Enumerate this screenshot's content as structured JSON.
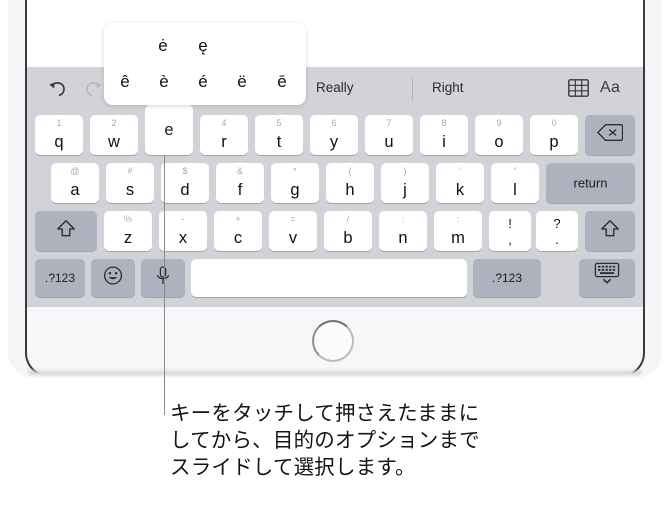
{
  "device": {
    "home_button": "home-button",
    "frame": "ipad-frame"
  },
  "keyboard": {
    "shortcut_bar": {
      "undo_icon": "undo-icon",
      "redo_icon": "redo-icon",
      "predictions": [
        "Really",
        "Right"
      ],
      "table_icon": "table-icon",
      "format_label": "Aa"
    },
    "accent_popup": {
      "row_top": [
        "ė",
        "ę"
      ],
      "row_bottom": [
        "ê",
        "è",
        "é",
        "ë",
        "ē"
      ]
    },
    "row1": [
      {
        "main": "q",
        "sub": "1"
      },
      {
        "main": "w",
        "sub": "2"
      },
      {
        "main": "e",
        "sub": "",
        "pressed": true
      },
      {
        "main": "r",
        "sub": "4"
      },
      {
        "main": "t",
        "sub": "5"
      },
      {
        "main": "y",
        "sub": "6"
      },
      {
        "main": "u",
        "sub": "7"
      },
      {
        "main": "i",
        "sub": "8"
      },
      {
        "main": "o",
        "sub": "9"
      },
      {
        "main": "p",
        "sub": "0"
      }
    ],
    "row1_backspace": "delete-key",
    "row2": [
      {
        "main": "a",
        "sub": "@"
      },
      {
        "main": "s",
        "sub": "#"
      },
      {
        "main": "d",
        "sub": "$"
      },
      {
        "main": "f",
        "sub": "&"
      },
      {
        "main": "g",
        "sub": "*"
      },
      {
        "main": "h",
        "sub": "("
      },
      {
        "main": "j",
        "sub": ")"
      },
      {
        "main": "k",
        "sub": "'"
      },
      {
        "main": "l",
        "sub": "\""
      }
    ],
    "row2_return": "return",
    "row3": [
      {
        "main": "z",
        "sub": "%"
      },
      {
        "main": "x",
        "sub": "-"
      },
      {
        "main": "c",
        "sub": "+"
      },
      {
        "main": "v",
        "sub": "="
      },
      {
        "main": "b",
        "sub": "/"
      },
      {
        "main": "n",
        "sub": ";"
      },
      {
        "main": "m",
        "sub": ":"
      }
    ],
    "row3_punct": [
      {
        "top": "!",
        "bottom": ","
      },
      {
        "top": "?",
        "bottom": "."
      }
    ],
    "row3_shift_left": "shift-key",
    "row3_shift_right": "shift-key",
    "row4": {
      "numeric_left": ".?123",
      "emoji_icon": "emoji-icon",
      "dictation_icon": "microphone-icon",
      "space": "",
      "numeric_right": ".?123",
      "hide_keyboard_icon": "hide-keyboard-icon"
    }
  },
  "caption": {
    "line1": "キーをタッチして押さえたままに",
    "line2": "してから、目的のオプションまで",
    "line3": "スライドして選択します。"
  },
  "colors": {
    "keyboard_bg": "#d1d3d9",
    "key_white": "#ffffff",
    "key_gray": "#aeb2be",
    "text": "#101012",
    "sub_text": "#a7a9ae",
    "callout_line": "#8a8a8e"
  }
}
